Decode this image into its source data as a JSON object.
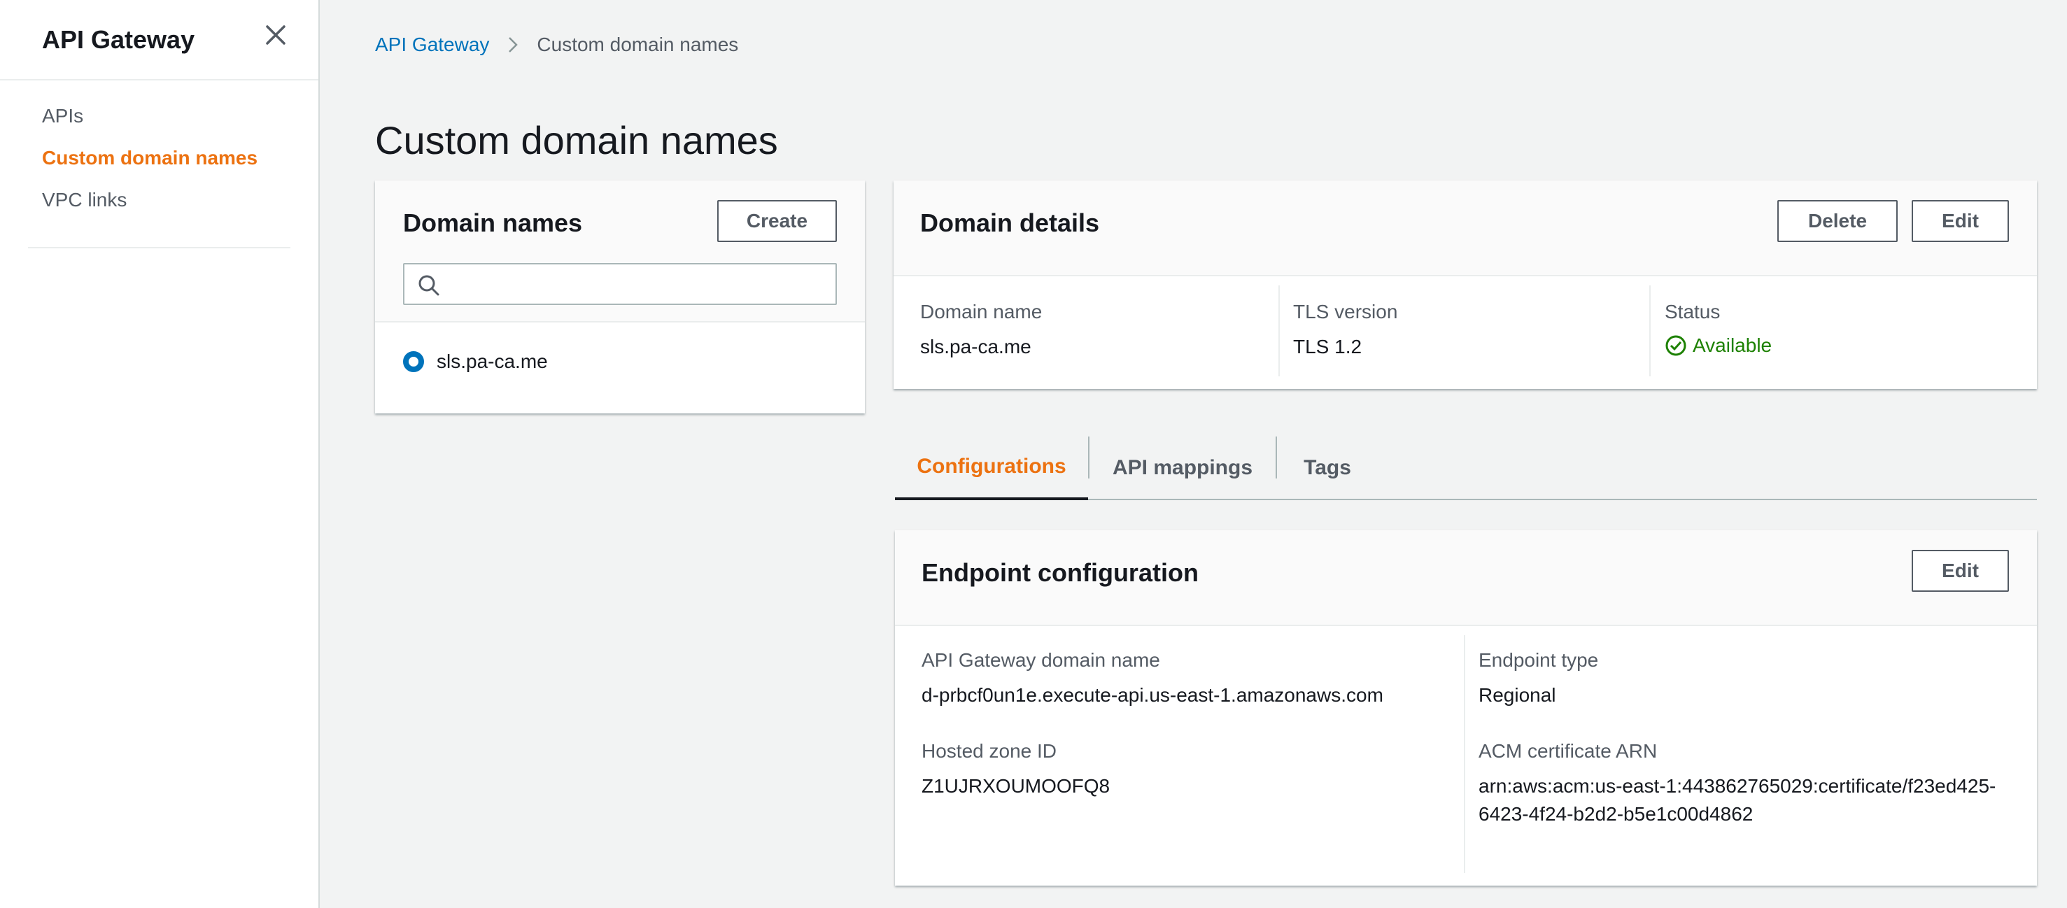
{
  "sidebar": {
    "title": "API Gateway",
    "close_icon": "close-icon",
    "items": [
      {
        "label": "APIs",
        "active": false
      },
      {
        "label": "Custom domain names",
        "active": true
      },
      {
        "label": "VPC links",
        "active": false
      }
    ]
  },
  "breadcrumb": {
    "root": "API Gateway",
    "separator_icon": "chevron-right-icon",
    "current": "Custom domain names"
  },
  "page": {
    "title": "Custom domain names"
  },
  "domains": {
    "title": "Domain names",
    "create_label": "Create",
    "search": {
      "value": "",
      "placeholder": ""
    },
    "items": [
      {
        "name": "sls.pa-ca.me",
        "selected": true
      }
    ]
  },
  "domain_details": {
    "title": "Domain details",
    "delete_label": "Delete",
    "edit_label": "Edit",
    "domain_name_label": "Domain name",
    "domain_name_value": "sls.pa-ca.me",
    "tls_label": "TLS version",
    "tls_value": "TLS 1.2",
    "status_label": "Status",
    "status_value": "Available"
  },
  "tabs": [
    {
      "label": "Configurations",
      "active": true
    },
    {
      "label": "API mappings",
      "active": false
    },
    {
      "label": "Tags",
      "active": false
    }
  ],
  "endpoint": {
    "title": "Endpoint configuration",
    "edit_label": "Edit",
    "gateway_domain_label": "API Gateway domain name",
    "gateway_domain_value": "d-prbcf0un1e.execute-api.us-east-1.amazonaws.com",
    "endpoint_type_label": "Endpoint type",
    "endpoint_type_value": "Regional",
    "hosted_zone_label": "Hosted zone ID",
    "hosted_zone_value": "Z1UJRXOUMOOFQ8",
    "acm_label": "ACM certificate ARN",
    "acm_value": "arn:aws:acm:us-east-1:443862765029:certificate/f23ed425-6423-4f24-b2d2-b5e1c00d4862"
  },
  "colors": {
    "accent": "#ec7211",
    "link": "#0073bb",
    "success": "#1d8102",
    "background": "#f2f3f3"
  }
}
